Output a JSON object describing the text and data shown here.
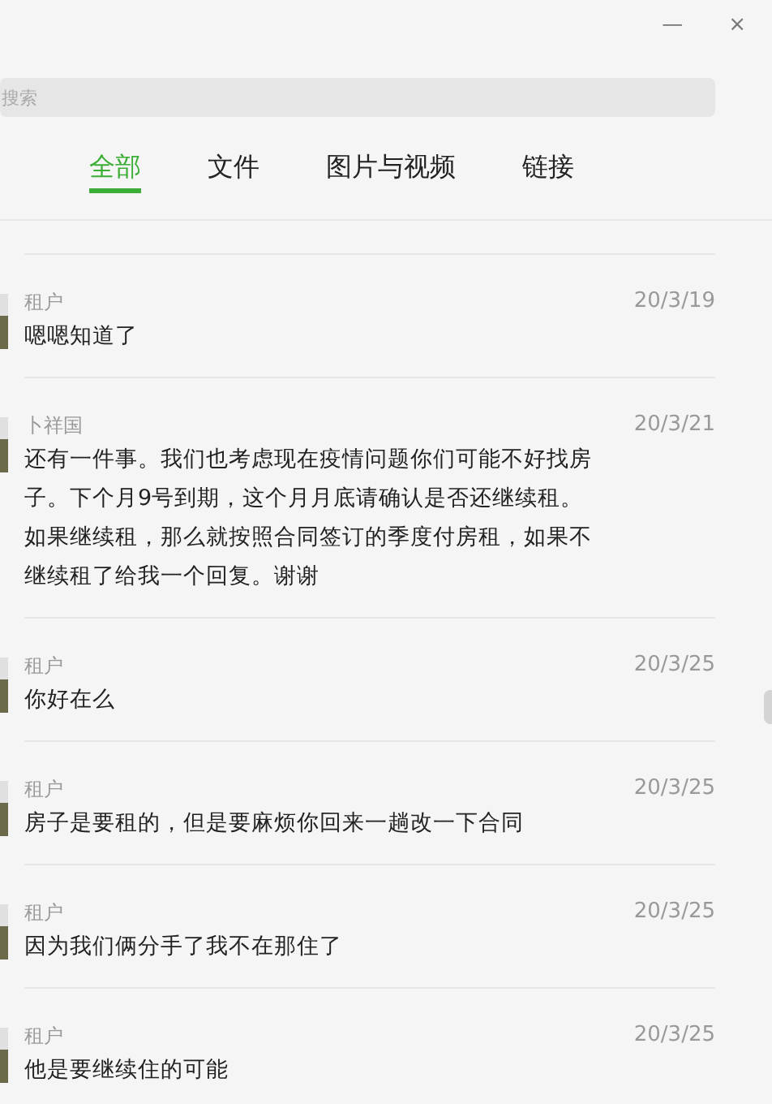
{
  "window": {
    "controls": [
      "—",
      "×"
    ]
  },
  "search": {
    "placeholder": "搜索"
  },
  "tabs": [
    {
      "label": "全部",
      "selected": true
    },
    {
      "label": "文件",
      "selected": false
    },
    {
      "label": "图片与视频",
      "selected": false
    },
    {
      "label": "链接",
      "selected": false
    }
  ],
  "messages": [
    {
      "sender": "租户",
      "date": "20/3/19",
      "text": "嗯嗯知道了"
    },
    {
      "sender": "卜祥国",
      "date": "20/3/21",
      "text": "还有一件事。我们也考虑现在疫情问题你们可能不好找房子。下个月9号到期，这个月月底请确认是否还继续租。如果继续租，那么就按照合同签订的季度付房租，如果不继续租了给我一个回复。谢谢"
    },
    {
      "sender": "租户",
      "date": "20/3/25",
      "text": "你好在么"
    },
    {
      "sender": "租户",
      "date": "20/3/25",
      "text": "房子是要租的，但是要麻烦你回来一趟改一下合同"
    },
    {
      "sender": "租户",
      "date": "20/3/25",
      "text": "因为我们俩分手了我不在那住了"
    },
    {
      "sender": "租户",
      "date": "20/3/25",
      "text": "他是要继续住的可能"
    }
  ]
}
